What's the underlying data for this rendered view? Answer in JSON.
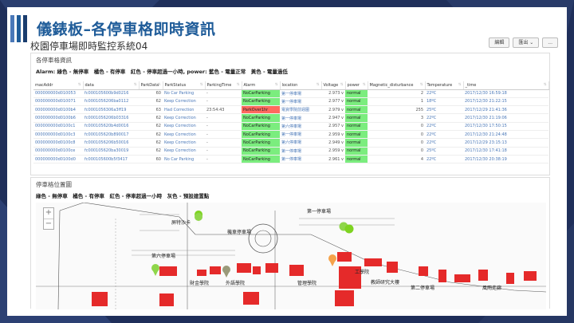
{
  "slide_title": "儀錶板–各停車格即時資訊",
  "app_title": "校園停車場即時監控系統04",
  "toolbar": {
    "edit": "編輯",
    "export": "匯出 ⌄",
    "more": "..."
  },
  "colors": {
    "accent": "#1f5c99",
    "ok": "#7bed7e",
    "alarm": "#ff6a5e"
  },
  "panel1": {
    "title": "各停車格資訊",
    "legend": "Alarm: 綠色 - 無停車　橘色 - 有停車　紅色 - 停車超過一小時,  power: 藍色 - 電量正常　黃色 - 電量過低",
    "headers": [
      "macAddr",
      "data",
      "ParkData",
      "ParkStatus",
      "ParkingTime",
      "Alarm",
      "location",
      "Voltage",
      "power",
      "Magnetic_disturbance",
      "Temperature",
      "_time"
    ],
    "rows": [
      [
        "000000000d010053",
        "fc000105600b9d0216",
        "60",
        "No Car Parking",
        "-",
        "NoCarParking",
        "第一停車場",
        "2.973 v",
        "normal",
        "2",
        "22ºC",
        "2017/12/30 16:59:18"
      ],
      [
        "000000000d010071",
        "fc0001056206ba0112",
        "62",
        "Keep Correction",
        "-",
        "NoCarParking",
        "第一停車場",
        "2.977 v",
        "normal",
        "1",
        "18ºC",
        "2017/12/30 21:22:15"
      ],
      [
        "000000000d0100b4",
        "fc0001056306a3ff19",
        "63",
        "Had Correction",
        "23:54:43",
        "ParkOver1hr",
        "電資學院前週圍",
        "2.979 v",
        "normal",
        "255",
        "25ºC",
        "2017/12/29 21:41:36"
      ],
      [
        "000000000d0100b6",
        "fc0001056206b03316",
        "62",
        "Keep Correction",
        "-",
        "NoCarParking",
        "第一停車場",
        "2.947 v",
        "normal",
        "3",
        "22ºC",
        "2017/12/30 21:19:06"
      ],
      [
        "000000000d0100c1",
        "fc000105620b4d0016",
        "62",
        "Keep Correction",
        "-",
        "NoCarParking",
        "第六停車場",
        "2.957 v",
        "normal",
        "0",
        "22ºC",
        "2017/12/30 17:50:15"
      ],
      [
        "000000000d0100c3",
        "fc000105620b890017",
        "62",
        "Keep Correction",
        "-",
        "NoCarParking",
        "第一停車場",
        "2.959 v",
        "normal",
        "0",
        "22ºC",
        "2017/12/30 21:24:48"
      ],
      [
        "000000000d0100c8",
        "fc0001056206b50016",
        "62",
        "Keep Correction",
        "-",
        "NoCarParking",
        "第六停車場",
        "2.949 v",
        "normal",
        "0",
        "22ºC",
        "2017/12/29 23:15:13"
      ],
      [
        "000000000d0100ce",
        "fc000105620ba30019",
        "62",
        "Keep Correction",
        "-",
        "NoCarParking",
        "第一停車場",
        "2.959 v",
        "normal",
        "0",
        "25ºC",
        "2017/12/30 17:41:18"
      ],
      [
        "000000000d0100d0",
        "fc000105600b5f3417",
        "60",
        "No Car Parking",
        "-",
        "NoCarParking",
        "第一停車場",
        "2.961 v",
        "normal",
        "4",
        "22ºC",
        "2017/12/30 20:38:19"
      ]
    ]
  },
  "panel2": {
    "title": "停車格位置圖",
    "legend": "綠色 - 無停車　橘色 - 有停車　紅色 - 停車超過一小時　灰色 - 預設建置點",
    "zoom_in": "+",
    "zoom_out": "−",
    "map_labels": {
      "l1": "第一停車場",
      "l2": "機車停車場",
      "l3": "第六停車場",
      "l4": "工學院",
      "l5": "財金學院",
      "l6": "外語學院",
      "l7": "管理學院",
      "l8": "教師研究大樓",
      "l9": "第二停車場",
      "l10": "風雨走廊",
      "l11": "第四停車場",
      "l12": "第五停車場",
      "l13": "屏特沙卡"
    }
  }
}
